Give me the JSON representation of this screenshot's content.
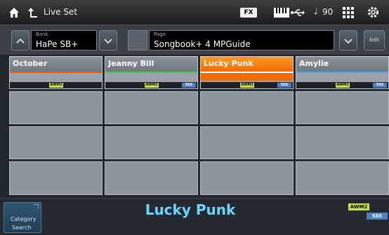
{
  "topbar": {
    "crumb": "Live Set",
    "fx": "FX",
    "tempo": "90"
  },
  "bank": {
    "label": "Bank",
    "value": "HaPe SB+"
  },
  "page": {
    "label": "Page",
    "value": "Songbook+ 4 MPGuide",
    "edit_label": "Edit"
  },
  "slots": [
    {
      "title": "October",
      "stripe": "#e05a1c",
      "awm": "AWM2",
      "sss": ""
    },
    {
      "title": "Jeanny Bill",
      "stripe": "#4cc05a",
      "awm": "AWM2",
      "sss": "SSS"
    },
    {
      "title": "Lucky Punk",
      "stripe": "#ffffff",
      "awm": "AWM2",
      "sss": "SSS",
      "active": true
    },
    {
      "title": "Amylie",
      "stripe": "#5aa0e0",
      "awm": "AWM2",
      "sss": "SSS"
    }
  ],
  "bottom": {
    "category_line1": "Category",
    "category_line2": "Search",
    "current": "Lucky Punk",
    "awm": "AWM2",
    "sss": "SSS"
  },
  "colors": {
    "active": "#f26a00",
    "highlight": "#6dd6ff"
  }
}
